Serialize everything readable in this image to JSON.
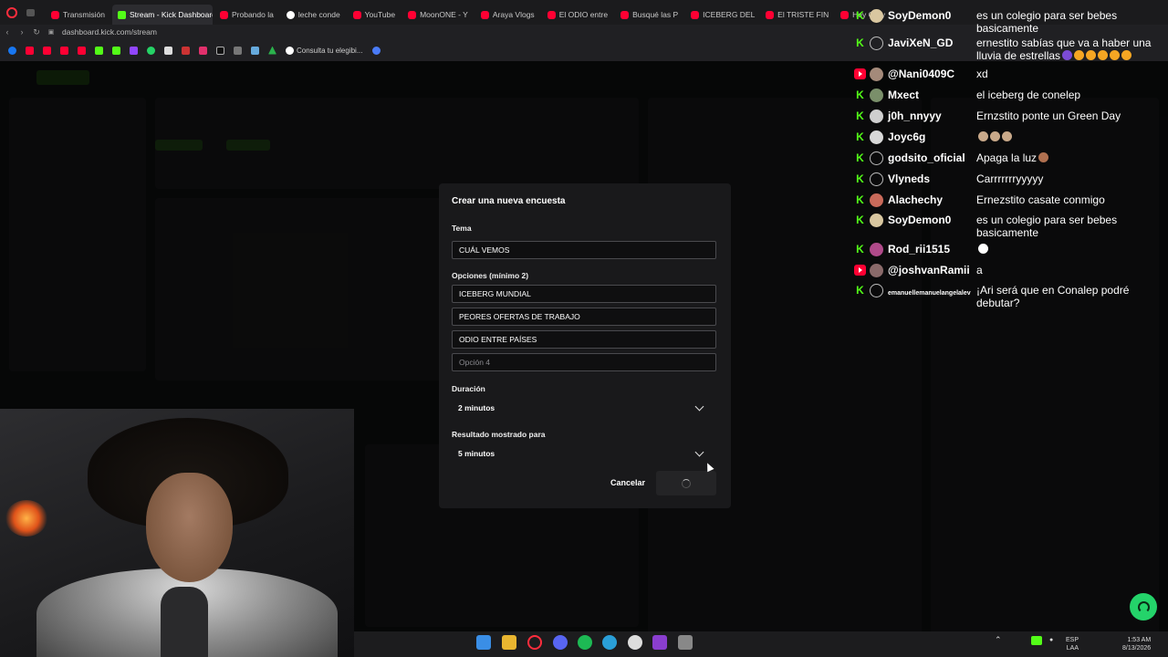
{
  "browser": {
    "tabs": [
      {
        "label": "Transmisión",
        "icon": "youtube-icon",
        "active": false
      },
      {
        "label": "Stream - Kick Dashboard",
        "icon": "kick-icon",
        "active": true
      },
      {
        "label": "Probando la",
        "icon": "youtube-icon",
        "active": false
      },
      {
        "label": "leche conde",
        "icon": "google-icon",
        "active": false
      },
      {
        "label": "YouTube",
        "icon": "youtube-icon",
        "active": false
      },
      {
        "label": "MoonONE - Y",
        "icon": "youtube-icon",
        "active": false
      },
      {
        "label": "Araya Vlogs",
        "icon": "youtube-icon",
        "active": false
      },
      {
        "label": "El ODIO entre",
        "icon": "youtube-icon",
        "active": false
      },
      {
        "label": "Busqué las P",
        "icon": "youtube-icon",
        "active": false
      },
      {
        "label": "ICEBERG DEL",
        "icon": "youtube-icon",
        "active": false
      },
      {
        "label": "El TRISTE FIN",
        "icon": "youtube-icon",
        "active": false
      },
      {
        "label": "Hey Grey",
        "icon": "youtube-icon",
        "active": false
      }
    ],
    "url": "dashboard.kick.com/stream",
    "bookmark_label": "Consulta tu elegibi..."
  },
  "modal": {
    "title": "Crear una nueva encuesta",
    "topic_label": "Tema",
    "topic_value": "CUÁL VEMOS",
    "options_label": "Opciones (mínimo 2)",
    "options": [
      {
        "value": "ICEBERG MUNDIAL",
        "placeholder": ""
      },
      {
        "value": "PEORES OFERTAS DE TRABAJO",
        "placeholder": ""
      },
      {
        "value": "ODIO ENTRE PAÍSES",
        "placeholder": ""
      },
      {
        "value": "",
        "placeholder": "Opción 4"
      }
    ],
    "duration_label": "Duración",
    "duration_value": "2 minutos",
    "result_label": "Resultado mostrado para",
    "result_value": "5 minutos",
    "cancel_label": "Cancelar"
  },
  "chat": [
    {
      "platform": "kick",
      "user": "SoyDemon0",
      "avatar_color": "#d9c7a0",
      "text": "es un colegio para ser bebes basicamente"
    },
    {
      "platform": "kick",
      "user": "JaviXeN_GD",
      "avatar_color": "",
      "text": "ernestito sabías que va a haber una lluvia de estrellas"
    },
    {
      "platform": "youtube",
      "user": "@Nani0409C",
      "avatar_color": "#a48a7a",
      "text": "xd"
    },
    {
      "platform": "kick",
      "user": "Mxect",
      "avatar_color": "#7a8f6a",
      "text": "el iceberg de conelep"
    },
    {
      "platform": "kick",
      "user": "j0h_nnyyy",
      "avatar_color": "#cfcfcf",
      "text": "Ernzstito ponte un Green Day"
    },
    {
      "platform": "kick",
      "user": "Joyc6g",
      "avatar_color": "#d8d8d8",
      "text": ""
    },
    {
      "platform": "kick",
      "user": "godsito_oficial",
      "avatar_color": "",
      "text": "Apaga la luz"
    },
    {
      "platform": "kick",
      "user": "Vlyneds",
      "avatar_color": "",
      "text": "Carrrrrrryyyyy"
    },
    {
      "platform": "kick",
      "user": "Alachechy",
      "avatar_color": "#c96a5a",
      "text": "Ernezstito casate conmigo"
    },
    {
      "platform": "kick",
      "user": "SoyDemon0",
      "avatar_color": "#d9c7a0",
      "text": "es un colegio para ser bebes basicamente"
    },
    {
      "platform": "kick",
      "user": "Rod_rii1515",
      "avatar_color": "#b04a8a",
      "text": ""
    },
    {
      "platform": "youtube",
      "user": "@joshvanRamii",
      "avatar_color": "#8a6a6a",
      "text": "a"
    },
    {
      "platform": "kick",
      "user": "emanuellemanuelangelalev",
      "avatar_color": "",
      "text": "¡Ari será que en Conalep podré debutar?"
    }
  ],
  "system_tray": {
    "language_top": "ESP",
    "language_bottom": "LAA",
    "time": "1:53 AM",
    "date": "8/13/2026"
  },
  "colors": {
    "kick_green": "#53fc18",
    "youtube_red": "#ff0033",
    "modal_bg": "#19191b"
  }
}
